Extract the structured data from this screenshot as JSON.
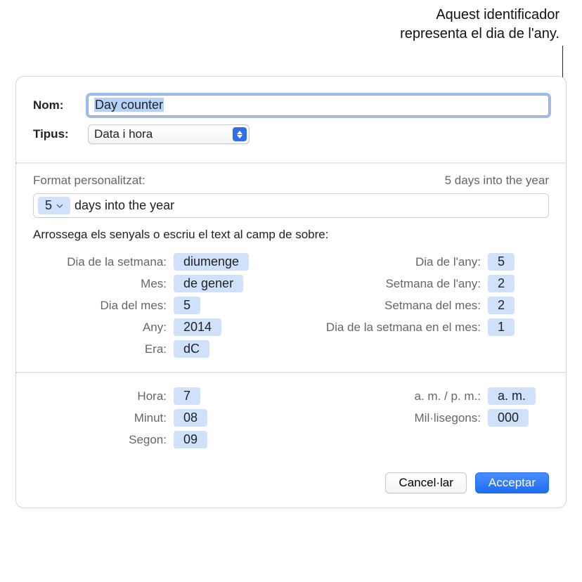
{
  "callout": {
    "line1": "Aquest identificador",
    "line2": "representa el dia de l'any."
  },
  "labels": {
    "name": "Nom:",
    "type": "Tipus:",
    "custom_format": "Format personalitzat:",
    "preview": "5 days into the year",
    "instructions": "Arrossega els senyals o escriu el text al camp de sobre:"
  },
  "fields": {
    "name_value": "Day counter",
    "type_value": "Data i hora"
  },
  "format_bar": {
    "token_value": "5",
    "literal": " days into the year"
  },
  "tokens_left": [
    {
      "label": "Dia de la setmana:",
      "value": "diumenge",
      "name": "token-day-of-week"
    },
    {
      "label": "Mes:",
      "value": "de gener",
      "name": "token-month"
    },
    {
      "label": "Dia del mes:",
      "value": "5",
      "name": "token-day-of-month"
    },
    {
      "label": "Any:",
      "value": "2014",
      "name": "token-year"
    },
    {
      "label": "Era:",
      "value": "dC",
      "name": "token-era"
    }
  ],
  "tokens_right": [
    {
      "label": "Dia de l'any:",
      "value": "5",
      "name": "token-day-of-year"
    },
    {
      "label": "Setmana de l'any:",
      "value": "2",
      "name": "token-week-of-year"
    },
    {
      "label": "Setmana del mes:",
      "value": "2",
      "name": "token-week-of-month"
    },
    {
      "label": "Dia de la setmana en el mes:",
      "value": "1",
      "name": "token-weekday-in-month"
    }
  ],
  "time_left": [
    {
      "label": "Hora:",
      "value": "7",
      "name": "token-hour"
    },
    {
      "label": "Minut:",
      "value": "08",
      "name": "token-minute"
    },
    {
      "label": "Segon:",
      "value": "09",
      "name": "token-second"
    }
  ],
  "time_right": [
    {
      "label": "a. m. / p. m.:",
      "value": "a. m.",
      "name": "token-ampm"
    },
    {
      "label": "Mil·lisegons:",
      "value": "000",
      "name": "token-millisecond"
    }
  ],
  "buttons": {
    "cancel": "Cancel·lar",
    "ok": "Acceptar"
  }
}
